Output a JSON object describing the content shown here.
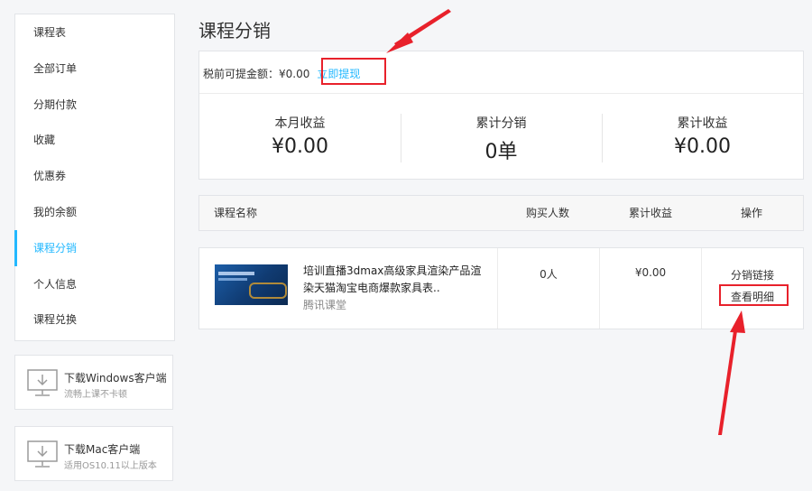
{
  "sidebar": {
    "items": [
      {
        "label": "课程表"
      },
      {
        "label": "全部订单"
      },
      {
        "label": "分期付款"
      },
      {
        "label": "收藏"
      },
      {
        "label": "优惠券"
      },
      {
        "label": "我的余额"
      },
      {
        "label": "课程分销",
        "active": true
      },
      {
        "label": "个人信息"
      },
      {
        "label": "课程兑换"
      }
    ]
  },
  "downloads": [
    {
      "title": "下载Windows客户端",
      "subtitle": "流畅上课不卡顿",
      "icon": "monitor-download-icon"
    },
    {
      "title": "下载Mac客户端",
      "subtitle": "适用OS10.11以上版本",
      "icon": "monitor-download-icon"
    }
  ],
  "page": {
    "title": "课程分销"
  },
  "summary": {
    "withdraw_label": "税前可提金额：¥0.00",
    "withdraw_link": "立即提现",
    "stats": [
      {
        "label": "本月收益",
        "value": "¥0.00"
      },
      {
        "label": "累计分销",
        "value": "0单"
      },
      {
        "label": "累计收益",
        "value": "¥0.00"
      }
    ]
  },
  "table": {
    "headers": [
      "课程名称",
      "购买人数",
      "累计收益",
      "操作"
    ],
    "rows": [
      {
        "title": "培训直播3dmax高级家具渲染产品渲染天猫淘宝电商爆款家具表..",
        "source": "腾讯课堂",
        "buyers": "0人",
        "earnings": "¥0.00",
        "actions": [
          "分销链接",
          "查看明细"
        ]
      }
    ]
  },
  "colors": {
    "accent": "#23b8ff",
    "annotation": "#e8212b"
  }
}
